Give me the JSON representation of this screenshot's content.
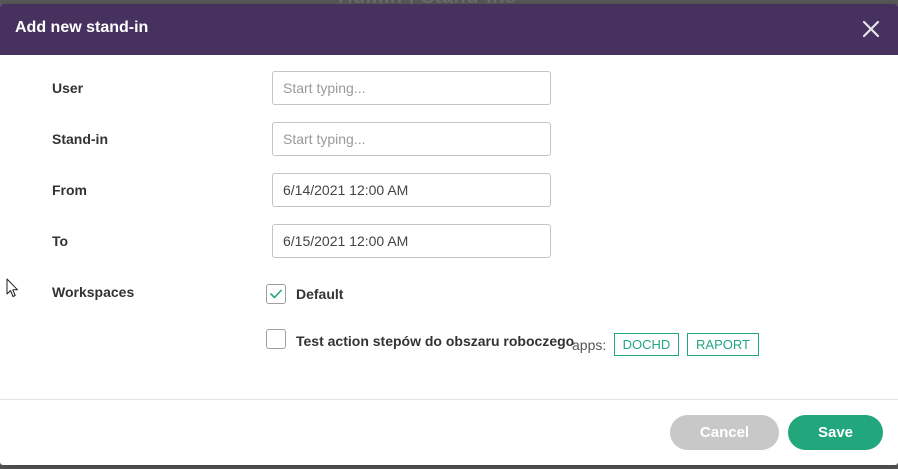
{
  "backdrop": {
    "title": "Admin | Stand-ins"
  },
  "dialog": {
    "title": "Add new stand-in",
    "close_icon": "close-icon"
  },
  "form": {
    "user": {
      "label": "User",
      "placeholder": "Start typing...",
      "value": ""
    },
    "stand_in": {
      "label": "Stand-in",
      "placeholder": "Start typing...",
      "value": ""
    },
    "from": {
      "label": "From",
      "value": "6/14/2021 12:00 AM"
    },
    "to": {
      "label": "To",
      "value": "6/15/2021 12:00 AM"
    },
    "workspaces": {
      "label": "Workspaces",
      "items": [
        {
          "name": "Default",
          "checked": true
        },
        {
          "name": "Test action stepów do obszaru roboczego",
          "checked": false,
          "apps_label": "apps:",
          "apps": [
            "DOCHD",
            "RAPORT"
          ]
        }
      ]
    }
  },
  "footer": {
    "cancel_label": "Cancel",
    "save_label": "Save"
  },
  "colors": {
    "header_bg": "#47325f",
    "accent": "#22a67c",
    "cancel_bg": "#c8c8c8"
  }
}
